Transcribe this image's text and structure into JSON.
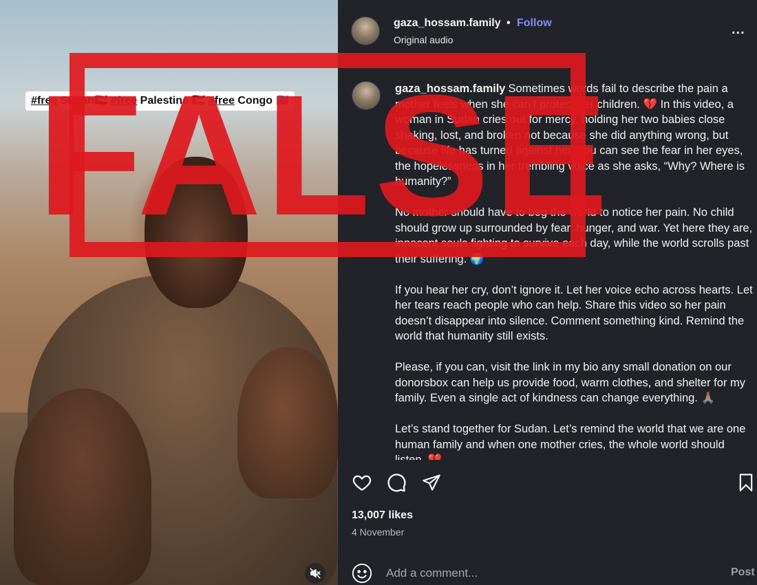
{
  "video": {
    "hashtags": [
      "#free",
      " Sudan🇸🇩 ",
      "#free",
      " Palestine 🇵🇸 ",
      "#free",
      " Congo 🇨🇩"
    ],
    "mute_icon": "muted-speaker-icon"
  },
  "stamp": {
    "label": "FALSE",
    "color": "#de191e"
  },
  "header": {
    "username": "gaza_hossam.family",
    "separator": "•",
    "follow_label": "Follow",
    "audio": "Original audio",
    "more": "..."
  },
  "caption": {
    "username": "gaza_hossam.family",
    "paragraphs": [
      "Sometimes words fail to describe the pain a mother feels when she can’t protect her children. 💔 In this video, a woman in Sudan cries out for mercy, holding her two babies close shaking, lost, and broken not because she did anything wrong, but because life has turned against her. You can see the fear in her eyes, the hopelessness in her trembling voice as she asks, “Why? Where is humanity?”",
      "No mother should have to beg the world to notice her pain. No child should grow up surrounded by fear, hunger, and war. Yet here they are, innocent souls fighting to survive each day, while the world scrolls past their suffering. 🌍",
      "If you hear her cry, don’t ignore it. Let her voice echo across hearts. Let her tears reach people who can help. Share this video so her pain doesn’t disappear into silence. Comment something kind. Remind the world that humanity still exists.",
      "Please, if you can, visit the link in my bio any small donation on our donorsbox can help us provide food, warm clothes, and shelter for my family. Even a single act of kindness can change everything. 🙏🏽",
      "Let’s stand together for Sudan. Let’s remind the world that we are one human family and when one mother cries, the whole world should listen. 💔"
    ]
  },
  "actions": {
    "like_icon": "heart-icon",
    "comment_icon": "comment-bubble-icon",
    "share_icon": "paper-plane-icon",
    "save_icon": "bookmark-icon"
  },
  "likes": "13,007 likes",
  "date": "4 November",
  "comment": {
    "emoji_icon": "smiley-icon",
    "placeholder": "Add a comment...",
    "post_label": "Post"
  }
}
